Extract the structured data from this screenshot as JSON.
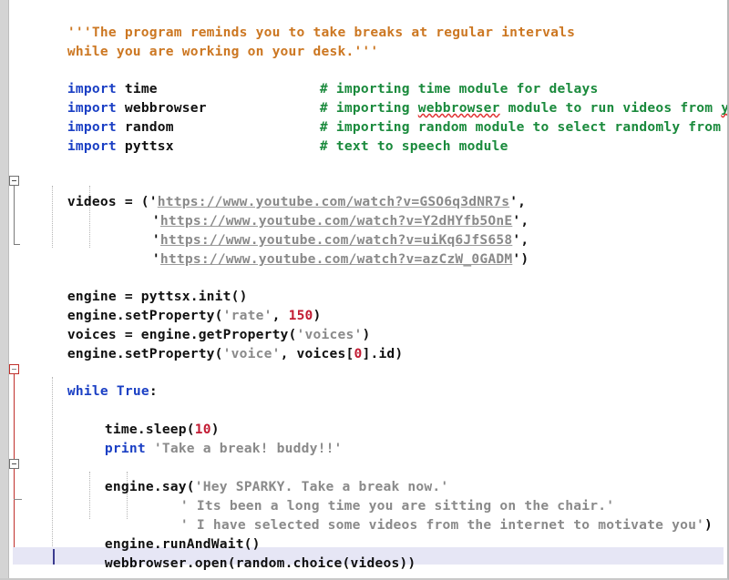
{
  "editor": {
    "title": "python-code-editor",
    "language": "Python",
    "colors": {
      "background": "#ffffff",
      "gutter": "#d4d4d4",
      "docstring": "#cc7722",
      "keyword": "#1a3fc4",
      "comment": "#1a8a3c",
      "string": "#8a8a8a",
      "number": "#c21b33",
      "plain": "#101010",
      "fold_marker_red": "#c0302b",
      "fold_marker_grey": "#707070",
      "current_line": "#e6e6f5",
      "spellcheck_underline": "#e03030"
    }
  },
  "code": {
    "docstring_line_1": "'''The program reminds you to take breaks at regular intervals",
    "docstring_line_2": "while you are working on your desk.'''",
    "imports": [
      {
        "keyword": "import",
        "module": "time",
        "comment": "# importing time module for delays"
      },
      {
        "keyword": "import",
        "module": "webbrowser",
        "comment": "# importing webbrowser module to run videos from youtube"
      },
      {
        "keyword": "import",
        "module": "random",
        "comment": "# importing random module to select randomly from a list"
      },
      {
        "keyword": "import",
        "module": "pyttsx",
        "comment": "# text to speech module"
      }
    ],
    "comment_segments": {
      "webbrowser_pre": "# importing ",
      "webbrowser_word": "webbrowser",
      "webbrowser_mid": " module to run videos from ",
      "youtube_word": "youtube"
    },
    "videos_assign": "videos = ('",
    "videos": [
      {
        "url": "https://www.youtube.com/watch?v=GSO6q3dNR7s",
        "suffix": "',"
      },
      {
        "url": "https://www.youtube.com/watch?v=Y2dHYfb5OnE",
        "suffix": "',"
      },
      {
        "url": "https://www.youtube.com/watch?v=uiKq6JfS658",
        "suffix": "',"
      },
      {
        "url": "https://www.youtube.com/watch?v=azCzW_0GADM",
        "suffix": "')"
      }
    ],
    "videos_quote_open": "'",
    "engine_init": "engine = pyttsx.init()",
    "set_rate_pre": "engine.setProperty(",
    "set_rate_str": "'rate'",
    "set_rate_mid": ", ",
    "set_rate_num": "150",
    "set_rate_post": ")",
    "voices_pre": "voices = engine.getProperty(",
    "voices_str": "'voices'",
    "voices_post": ")",
    "set_voice_pre": "engine.setProperty(",
    "set_voice_str": "'voice'",
    "set_voice_mid": ", voices[",
    "set_voice_num": "0",
    "set_voice_post": "].id",
    "set_voice_close": ")",
    "while_keyword": "while",
    "while_true": "True",
    "while_colon": ":",
    "sleep_pre": "time.sleep(",
    "sleep_num": "10",
    "sleep_post": ")",
    "print_keyword": "print",
    "print_string": "'Take a break! buddy!!'",
    "say_pre": "engine.say(",
    "say_string_1": "'Hey SPARKY. Take a break now.'",
    "say_string_2": "' Its been a long time you are sitting on the chair.'",
    "say_string_3": "' I have selected some videos from the internet to motivate you'",
    "say_close": ")",
    "run_and_wait": "engine.runAndWait()",
    "open_browser": "webbrowser.open(random.choice(videos))"
  }
}
